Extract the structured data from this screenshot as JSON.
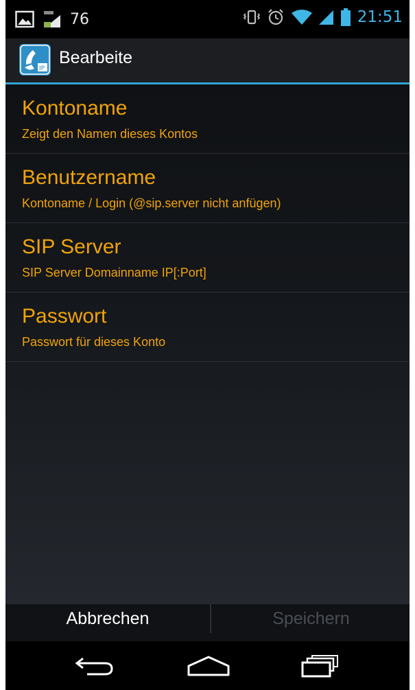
{
  "status_bar": {
    "notification_count": "76",
    "time": "21:51",
    "icons": [
      "image-icon",
      "data-signal-icon",
      "vibrate-icon",
      "alarm-icon",
      "wifi-icon",
      "cell-signal-icon",
      "battery-icon"
    ]
  },
  "action_bar": {
    "title": "Bearbeite",
    "app_icon": "phone-ip-icon"
  },
  "preferences": [
    {
      "title": "Kontoname",
      "summary": "Zeigt den Namen dieses Kontos"
    },
    {
      "title": "Benutzername",
      "summary": "Kontoname / Login (@sip.server nicht anfügen)"
    },
    {
      "title": "SIP Server",
      "summary": "SIP Server Domainname IP[:Port]"
    },
    {
      "title": "Passwort",
      "summary": "Passwort für dieses Konto"
    }
  ],
  "buttons": {
    "cancel_label": "Abbrechen",
    "save_label": "Speichern"
  },
  "colors": {
    "accent_orange": "#f0a30a",
    "holo_blue": "#33a5d6",
    "disabled_text": "#4a4e54"
  },
  "navigation": [
    "back-icon",
    "home-icon",
    "recent-apps-icon"
  ]
}
